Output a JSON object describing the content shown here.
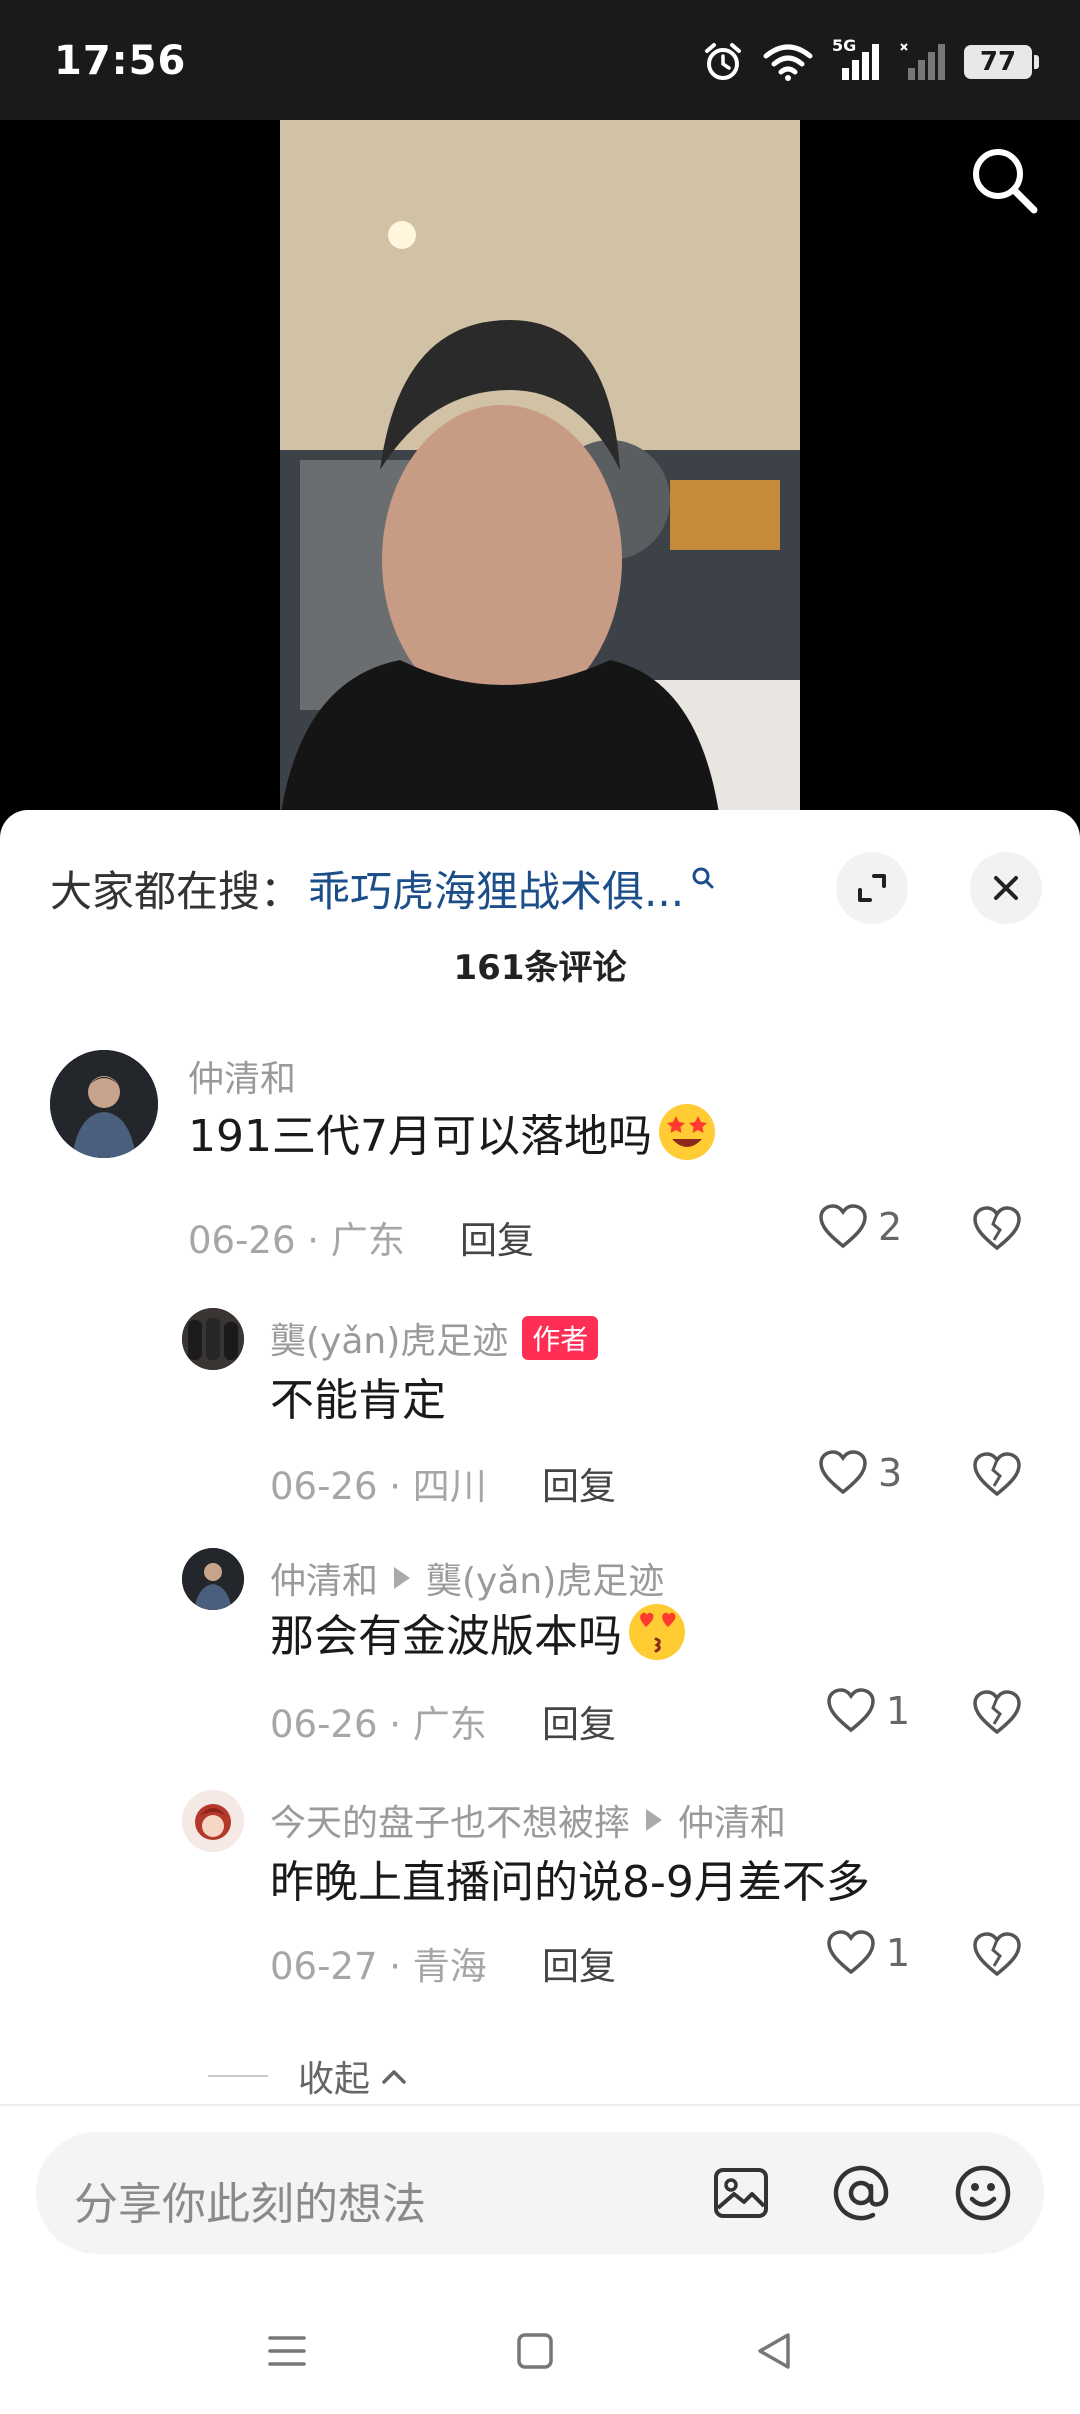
{
  "status_bar": {
    "time": "17:56",
    "network": "5G",
    "battery": "77"
  },
  "video": {
    "search_icon": "search-icon"
  },
  "panel": {
    "search_prefix": "大家都在搜：",
    "search_term": "乖巧虎海狸战术俱...",
    "comment_count": "161条评论",
    "expand_icon": "expand-icon",
    "close_icon": "close-icon"
  },
  "comments": [
    {
      "name": "仲清和",
      "text": "191三代7月可以落地吗",
      "emoji": "star-struck",
      "date": "06-26 · 广东",
      "reply": "回复",
      "likes": "2"
    },
    {
      "name": "龑(yǎn)虎足迹",
      "badge": "作者",
      "text": "不能肯定",
      "date": "06-26 · 四川",
      "reply": "回复",
      "likes": "3"
    },
    {
      "name": "仲清和",
      "reply_to": "龑(yǎn)虎足迹",
      "text": "那会有金波版本吗",
      "emoji": "kissing-heart",
      "date": "06-26 · 广东",
      "reply": "回复",
      "likes": "1"
    },
    {
      "name": "今天的盘子也不想被摔",
      "reply_to": "仲清和",
      "text": "昨晚上直播问的说8-9月差不多",
      "date": "06-27 · 青海",
      "reply": "回复",
      "likes": "1"
    }
  ],
  "collapse_label": "收起",
  "input": {
    "placeholder": "分享你此刻的想法"
  },
  "colors": {
    "link": "#1c4e8a",
    "badge": "#ff2e55",
    "muted": "#9a9a9a"
  }
}
